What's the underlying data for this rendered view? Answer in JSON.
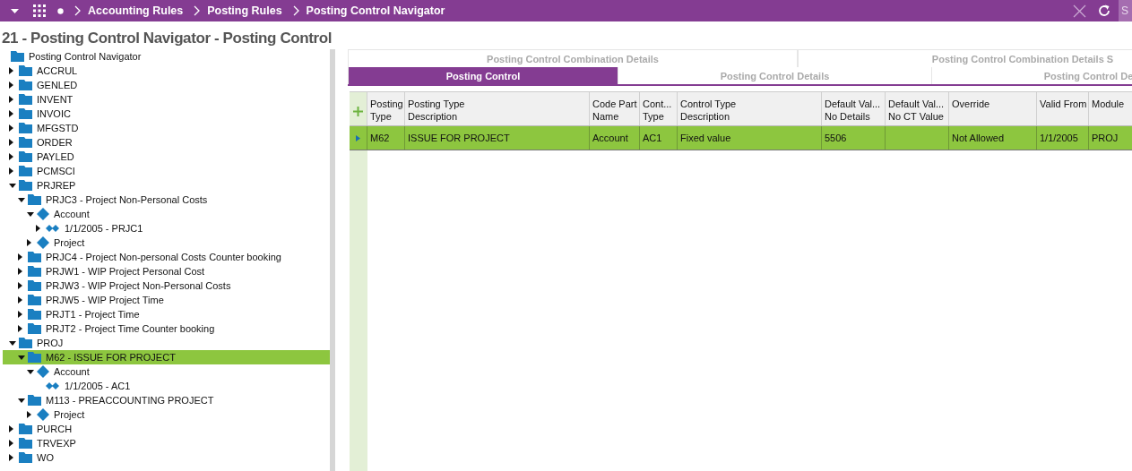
{
  "breadcrumbs": [
    "Accounting Rules",
    "Posting Rules",
    "Posting Control Navigator"
  ],
  "search": {
    "placeholder": "S"
  },
  "title": "21 - Posting Control Navigator - Posting Control",
  "tree": {
    "label": "Posting Control Navigator",
    "kind": "folder",
    "children": [
      {
        "label": "ACCRUL",
        "kind": "folder",
        "expanded": false,
        "selected": false
      },
      {
        "label": "GENLED",
        "kind": "folder",
        "expanded": false,
        "selected": false
      },
      {
        "label": "INVENT",
        "kind": "folder",
        "expanded": false,
        "selected": false
      },
      {
        "label": "INVOIC",
        "kind": "folder",
        "expanded": false,
        "selected": false
      },
      {
        "label": "MFGSTD",
        "kind": "folder",
        "expanded": false,
        "selected": false
      },
      {
        "label": "ORDER",
        "kind": "folder",
        "expanded": false,
        "selected": false
      },
      {
        "label": "PAYLED",
        "kind": "folder",
        "expanded": false,
        "selected": false
      },
      {
        "label": "PCMSCI",
        "kind": "folder",
        "expanded": false,
        "selected": false
      },
      {
        "label": "PRJREP",
        "kind": "folder",
        "expanded": true,
        "selected": false,
        "children": [
          {
            "label": "PRJC3 - Project Non-Personal Costs",
            "kind": "folder",
            "expanded": true,
            "selected": false,
            "children": [
              {
                "label": "Account",
                "kind": "diamond",
                "expanded": true,
                "selected": false,
                "children": [
                  {
                    "label": "1/1/2005 - PRJC1",
                    "kind": "pair",
                    "expanded": false,
                    "selected": false
                  }
                ]
              },
              {
                "label": "Project",
                "kind": "diamond",
                "expanded": false,
                "selected": false
              }
            ]
          },
          {
            "label": "PRJC4 - Project Non-personal Costs Counter booking",
            "kind": "folder",
            "expanded": false,
            "selected": false
          },
          {
            "label": "PRJW1 - WIP Project Personal Cost",
            "kind": "folder",
            "expanded": false,
            "selected": false
          },
          {
            "label": "PRJW3 - WIP Project Non-Personal Costs",
            "kind": "folder",
            "expanded": false,
            "selected": false
          },
          {
            "label": "PRJW5 - WIP Project Time",
            "kind": "folder",
            "expanded": false,
            "selected": false
          },
          {
            "label": "PRJT1 - Project Time",
            "kind": "folder",
            "expanded": false,
            "selected": false
          },
          {
            "label": "PRJT2 - Project Time Counter booking",
            "kind": "folder",
            "expanded": false,
            "selected": false
          }
        ]
      },
      {
        "label": "PROJ",
        "kind": "folder",
        "expanded": true,
        "selected": false,
        "children": [
          {
            "label": "M62 - ISSUE FOR PROJECT",
            "kind": "folder",
            "expanded": true,
            "selected": true,
            "children": [
              {
                "label": "Account",
                "kind": "diamond",
                "expanded": true,
                "selected": false,
                "children": [
                  {
                    "label": "1/1/2005 - AC1",
                    "kind": "pair",
                    "selected": false
                  }
                ]
              }
            ]
          },
          {
            "label": "M113 - PREACCOUNTING PROJECT",
            "kind": "folder",
            "expanded": true,
            "selected": false,
            "children": [
              {
                "label": "Project",
                "kind": "diamond",
                "expanded": false,
                "selected": false
              }
            ]
          }
        ]
      },
      {
        "label": "PURCH",
        "kind": "folder",
        "expanded": false,
        "selected": false
      },
      {
        "label": "TRVEXP",
        "kind": "folder",
        "expanded": false,
        "selected": false
      },
      {
        "label": "WO",
        "kind": "folder",
        "expanded": false,
        "selected": false
      }
    ]
  },
  "upper_tabs": [
    {
      "label": "Posting Control Combination Details",
      "selected": false
    },
    {
      "label": "Posting Control Combination Details S",
      "selected": false
    }
  ],
  "tabs": [
    {
      "label": "Posting Control",
      "selected": true
    },
    {
      "label": "Posting Control Details",
      "selected": false
    },
    {
      "label": "Posting Control De",
      "selected": false
    }
  ],
  "table": {
    "columns": [
      "Posting\nType",
      "Posting Type\nDescription",
      "Code Part\nName",
      "Cont...\nType",
      "Control Type\nDescription",
      "Default Val...\nNo Details",
      "Default Val...\nNo CT Value",
      "Override",
      "Valid From",
      "Module"
    ],
    "rows": [
      {
        "selected": true,
        "cells": [
          "M62",
          "ISSUE FOR PROJECT",
          "Account",
          "AC1",
          "Fixed value",
          "5506",
          "",
          "Not Allowed",
          "1/1/2005",
          "PROJ"
        ]
      }
    ]
  }
}
